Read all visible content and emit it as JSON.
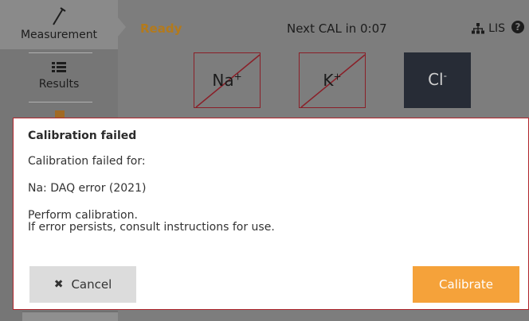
{
  "sidebar": {
    "items": [
      {
        "label": "Measurement",
        "icon": "syringe-icon"
      },
      {
        "label": "Results",
        "icon": "list-icon"
      }
    ]
  },
  "header": {
    "status": "Ready",
    "next_cal": "Next CAL in 0:07",
    "lis_label": "LIS",
    "help_glyph": "?"
  },
  "analytes": [
    {
      "symbol": "Na",
      "charge": "+",
      "state": "failed"
    },
    {
      "symbol": "K",
      "charge": "+",
      "state": "failed"
    },
    {
      "symbol": "Cl",
      "charge": "-",
      "state": "active"
    }
  ],
  "dialog": {
    "title": "Calibration failed",
    "line1": "Calibration failed for:",
    "line2": "Na: DAQ error (2021)",
    "line3": "Perform calibration.",
    "line4": "If error persists, consult instructions for use.",
    "cancel_label": "Cancel",
    "calibrate_label": "Calibrate"
  },
  "colors": {
    "status_ready": "#b37a1c",
    "dialog_border": "#b1262d",
    "calibrate_button": "#f5a23a",
    "analyte_active": "#272c36"
  }
}
